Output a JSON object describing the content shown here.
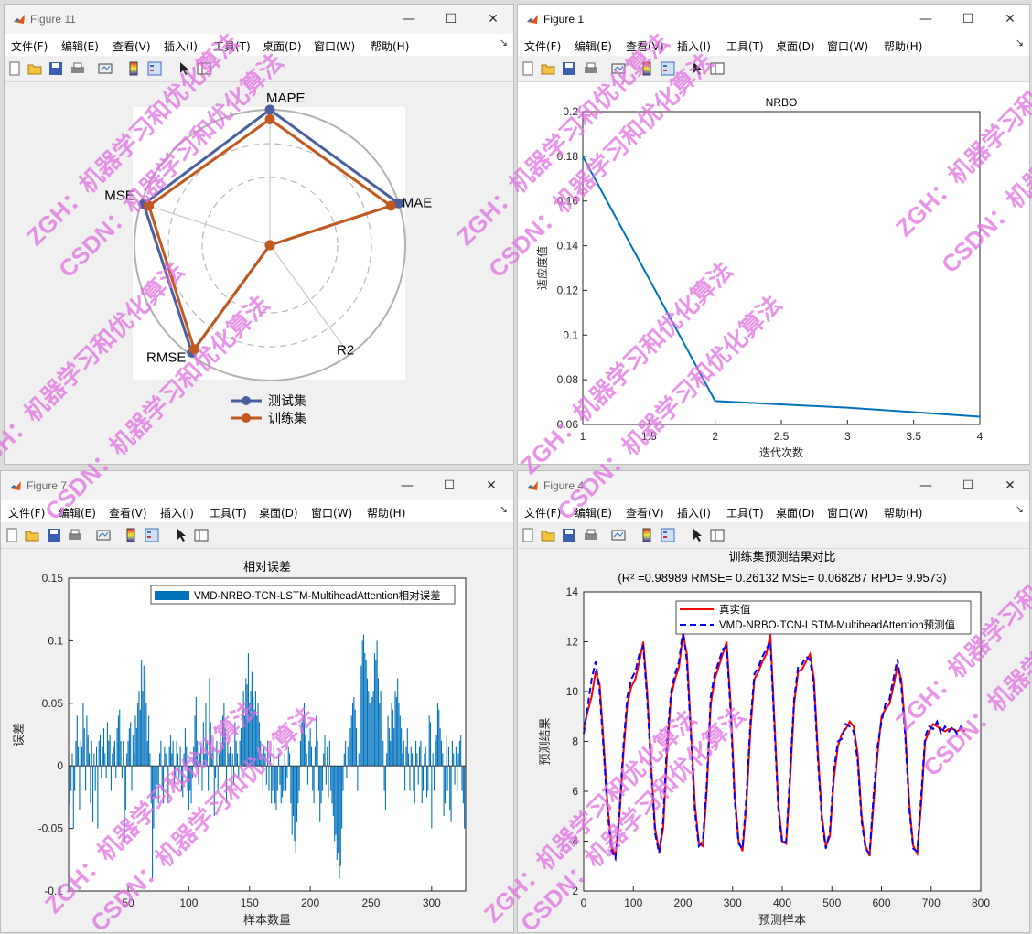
{
  "menus": [
    "文件(F)",
    "编辑(E)",
    "查看(V)",
    "插入(I)",
    "工具(T)",
    "桌面(D)",
    "窗口(W)",
    "帮助(H)"
  ],
  "window_controls": {
    "min": "—",
    "max": "☐",
    "close": "✕"
  },
  "menu_more": "↘",
  "toolbar_icons": [
    "new-figure-icon",
    "open-icon",
    "save-icon",
    "print-icon",
    "link-plot-icon",
    "insert-colorbar-icon",
    "insert-legend-icon",
    "pointer-icon",
    "property-inspector-icon"
  ],
  "watermark": {
    "line1": "ZGH：机器学习和优化算法",
    "line2": "CSDN：机器学习和优化算法",
    "color": "#e070e0"
  },
  "windows": {
    "fig11": {
      "title": "Figure 11"
    },
    "fig1": {
      "title": "Figure 1"
    },
    "fig7": {
      "title": "Figure 7"
    },
    "fig4": {
      "title": "Figure 4"
    }
  },
  "radar": {
    "axes": [
      "MAPE",
      "MAE",
      "R2",
      "RMSE",
      "MSE"
    ],
    "legend": [
      "测试集",
      "训练集"
    ],
    "colors": [
      "#4a5f9e",
      "#c1591f"
    ],
    "series": [
      {
        "name": "测试集",
        "values": [
          1.0,
          1.0,
          0.0,
          0.98,
          0.98
        ]
      },
      {
        "name": "训练集",
        "values": [
          0.93,
          0.94,
          0.0,
          0.95,
          0.94
        ]
      }
    ]
  },
  "chart_data": [
    {
      "type": "radar",
      "axes": [
        "MAPE",
        "MAE",
        "R2",
        "RMSE",
        "MSE"
      ],
      "series": [
        {
          "name": "测试集",
          "values": [
            1.0,
            1.0,
            0.0,
            0.98,
            0.98
          ]
        },
        {
          "name": "训练集",
          "values": [
            0.93,
            0.94,
            0.0,
            0.95,
            0.94
          ]
        }
      ]
    },
    {
      "type": "line",
      "title": "NRBO",
      "xlabel": "迭代次数",
      "ylabel": "适应度值",
      "x": [
        1,
        2,
        3,
        4
      ],
      "y": [
        0.18,
        0.0705,
        0.0675,
        0.0635
      ],
      "xlim": [
        1,
        4
      ],
      "ylim": [
        0.06,
        0.2
      ],
      "xticks": [
        "1",
        "1.5",
        "2",
        "2.5",
        "3",
        "3.5",
        "4"
      ],
      "yticks": [
        "0.06",
        "0.08",
        "0.1",
        "0.12",
        "0.14",
        "0.16",
        "0.18",
        "0.2"
      ],
      "color": "#0072bd"
    },
    {
      "type": "bar",
      "title": "相对误差",
      "xlabel": "样本数量",
      "ylabel": "误差",
      "legend": "VMD-NRBO-TCN-LSTM-MultiheadAttention相对误差",
      "xlim": [
        1,
        328
      ],
      "ylim": [
        -0.1,
        0.15
      ],
      "xticks": [
        "50",
        "100",
        "150",
        "200",
        "250",
        "300"
      ],
      "yticks": [
        "-0.1",
        "-0.05",
        "0",
        "0.05",
        "0.1",
        "0.15"
      ],
      "color": "#0072bd",
      "values": [
        -0.04,
        -0.03,
        -0.02,
        0.01,
        -0.05,
        -0.02,
        0.02,
        0.04,
        0.015,
        -0.035,
        0.02,
        0.015,
        0.05,
        0.03,
        -0.02,
        0.04,
        0.025,
        0.01,
        -0.03,
        0.02,
        -0.045,
        0.01,
        -0.02,
        0.015,
        -0.05,
        0.02,
        0.025,
        -0.01,
        0.015,
        0.03,
        0.01,
        -0.01,
        0.035,
        0.02,
        0.025,
        -0.02,
        0.01,
        0.015,
        0.02,
        -0.01,
        0.03,
        0.04,
        0.045,
        0.02,
        -0.01,
        0.02,
        -0.06,
        -0.035,
        0.01,
        0.02,
        0.03,
        0.035,
        -0.02,
        0.025,
        0.01,
        0.04,
        0.03,
        0.05,
        0.06,
        0.045,
        0.085,
        0.06,
        0.08,
        0.07,
        0.05,
        0.02,
        0.04,
        0.01,
        -0.03,
        -0.09,
        -0.05,
        -0.025,
        -0.04,
        -0.015,
        -0.03,
        0.01,
        0.02,
        -0.02,
        -0.03,
        0.015,
        0.01,
        -0.02,
        -0.03,
        0.015,
        0.025,
        0.01,
        0.02,
        -0.015,
        -0.01,
        0.02,
        0.01,
        -0.01,
        0.015,
        -0.02,
        -0.025,
        0.01,
        0.03,
        0.015,
        -0.02,
        -0.035,
        -0.02,
        -0.03,
        -0.01,
        0.015,
        0.04,
        0.055,
        0.02,
        -0.015,
        0.01,
        0.015,
        -0.02,
        0.035,
        0.01,
        0.05,
        0.02,
        -0.02,
        0.07,
        0.035,
        0.01,
        0.015,
        -0.04,
        -0.01,
        0.02,
        -0.02,
        0.01,
        0.025,
        0.015,
        0.04,
        0.05,
        0.03,
        -0.03,
        0.02,
        0.01,
        0.015,
        -0.02,
        0.01,
        -0.015,
        0.035,
        0.02,
        0.01,
        -0.01,
        0.02,
        0.03,
        0.045,
        0.06,
        0.04,
        0.07,
        0.065,
        0.09,
        0.05,
        0.06,
        0.075,
        0.055,
        0.045,
        0.06,
        0.04,
        0.05,
        0.035,
        0.02,
        0.01,
        -0.02,
        0.015,
        0.01,
        -0.015,
        0.02,
        -0.02,
        0.01,
        -0.03,
        -0.02,
        0.015,
        -0.03,
        -0.035,
        -0.02,
        0.01,
        -0.015,
        -0.03,
        -0.025,
        -0.02,
        0.01,
        -0.02,
        -0.01,
        0.015,
        0.01,
        -0.03,
        -0.055,
        -0.04,
        -0.06,
        -0.07,
        -0.045,
        -0.03,
        -0.02,
        0.02,
        0.035,
        0.04,
        0.05,
        0.025,
        0.01,
        -0.015,
        0.02,
        0.03,
        0.015,
        -0.02,
        -0.03,
        0.015,
        0.04,
        0.02,
        -0.02,
        -0.045,
        -0.03,
        -0.02,
        0.01,
        0.025,
        -0.015,
        0.015,
        -0.025,
        0.02,
        -0.02,
        -0.03,
        -0.04,
        -0.06,
        -0.055,
        -0.075,
        -0.07,
        -0.09,
        -0.08,
        -0.05,
        -0.02,
        0.01,
        0.02,
        -0.01,
        0.015,
        0.02,
        0.03,
        0.04,
        0.05,
        0.055,
        0.045,
        0.03,
        -0.02,
        0.01,
        0.06,
        0.08,
        0.1,
        0.105,
        0.09,
        0.085,
        0.07,
        0.06,
        0.05,
        0.075,
        0.055,
        0.06,
        0.09,
        0.085,
        0.1,
        0.07,
        0.05,
        0.06,
        0.035,
        0.02,
        -0.02,
        -0.035,
        0.01,
        0.04,
        0.03,
        0.02,
        0.05,
        0.045,
        0.03,
        0.06,
        0.055,
        0.07,
        0.05,
        0.04,
        0.03,
        0.01,
        0.02,
        -0.02,
        0.015,
        0.03,
        0.01,
        -0.02,
        0.015,
        0.01,
        -0.02,
        -0.03,
        0.02,
        0.01,
        -0.015,
        0.015,
        0.02,
        -0.03,
        -0.02,
        0.01,
        0.015,
        -0.025,
        -0.02,
        0.04,
        0.035,
        -0.05,
        0.01,
        -0.02,
        0.02,
        0.025,
        0.05,
        0.045,
        0.03,
        0.02,
        0.01,
        -0.04,
        -0.03,
        0.025,
        -0.02,
        0.015,
        -0.035,
        -0.045,
        0.02,
        0.01,
        -0.015,
        0.015,
        -0.02,
        0.01,
        0.02,
        0.025,
        -0.02,
        -0.03,
        -0.05
      ]
    },
    {
      "type": "line",
      "title": "训练集预测结果对比",
      "subtitle": "(R² =0.98989 RMSE= 0.26132 MSE= 0.068287 RPD= 9.9573)",
      "xlabel": "预测样本",
      "ylabel": "预测结果",
      "xlim": [
        0,
        800
      ],
      "ylim": [
        2,
        14
      ],
      "xticks": [
        "0",
        "100",
        "200",
        "300",
        "400",
        "500",
        "600",
        "700",
        "800"
      ],
      "yticks": [
        "2",
        "4",
        "6",
        "8",
        "10",
        "12",
        "14"
      ],
      "series": [
        {
          "name": "真实值",
          "color": "#ff0000",
          "dash": false
        },
        {
          "name": "VMD-NRBO-TCN-LSTM-MultiheadAttention预测值",
          "color": "#0000ff",
          "dash": true
        }
      ],
      "points_x": [
        0,
        8,
        16,
        24,
        32,
        40,
        48,
        56,
        64,
        72,
        80,
        88,
        96,
        104,
        112,
        120,
        128,
        136,
        144,
        152,
        160,
        168,
        176,
        184,
        192,
        200,
        208,
        216,
        224,
        232,
        240,
        248,
        256,
        264,
        272,
        280,
        288,
        296,
        304,
        312,
        320,
        328,
        336,
        344,
        352,
        360,
        368,
        376,
        384,
        392,
        400,
        408,
        416,
        424,
        432,
        440,
        448,
        456,
        464,
        472,
        480,
        488,
        496,
        504,
        512,
        520,
        528,
        536,
        544,
        552,
        560,
        568,
        576,
        584,
        592,
        600,
        608,
        616,
        624,
        632,
        640,
        648,
        656,
        664,
        672,
        680,
        688,
        696,
        704,
        712,
        720,
        728,
        736,
        744,
        752,
        760,
        768
      ],
      "true_y": [
        8.5,
        9.2,
        9.8,
        10.8,
        10.3,
        8.0,
        5.5,
        3.8,
        3.4,
        5.0,
        7.5,
        9.5,
        10.2,
        10.5,
        11.2,
        12.0,
        10.0,
        7.0,
        4.5,
        3.6,
        4.5,
        7.5,
        9.8,
        10.5,
        11.0,
        12.3,
        11.5,
        8.5,
        5.5,
        3.9,
        3.8,
        6.0,
        9.5,
        10.5,
        11.0,
        11.5,
        12.0,
        9.5,
        6.0,
        4.0,
        3.6,
        5.5,
        8.5,
        10.5,
        10.8,
        11.2,
        11.5,
        12.3,
        9.0,
        5.5,
        4.0,
        3.9,
        6.5,
        9.5,
        10.8,
        10.9,
        11.2,
        11.5,
        10.5,
        7.5,
        5.0,
        3.8,
        4.2,
        6.5,
        7.8,
        8.3,
        8.5,
        8.8,
        8.6,
        7.5,
        5.0,
        3.8,
        3.4,
        5.5,
        7.5,
        9.0,
        9.3,
        9.5,
        10.2,
        11.0,
        10.5,
        8.5,
        5.5,
        3.8,
        3.5,
        5.5,
        8.0,
        8.4,
        8.7,
        8.6,
        8.5,
        8.4,
        8.5,
        8.5,
        8.4,
        8.5,
        8.4
      ],
      "pred_y": [
        8.3,
        9.4,
        10.5,
        11.2,
        10.0,
        7.7,
        5.2,
        3.6,
        3.3,
        5.2,
        7.8,
        9.8,
        10.5,
        10.8,
        11.5,
        11.8,
        9.7,
        6.8,
        4.3,
        3.5,
        4.8,
        8.0,
        10.0,
        10.7,
        11.2,
        12.5,
        11.2,
        8.2,
        5.2,
        3.8,
        4.0,
        6.3,
        9.8,
        10.7,
        11.2,
        11.7,
        11.8,
        9.2,
        5.7,
        3.9,
        3.7,
        5.8,
        8.8,
        10.7,
        11.0,
        11.4,
        11.7,
        12.0,
        8.7,
        5.3,
        3.9,
        4.0,
        6.8,
        9.7,
        11.0,
        11.1,
        11.4,
        11.3,
        10.2,
        7.2,
        4.8,
        3.7,
        4.4,
        6.8,
        8.0,
        8.1,
        8.7,
        8.6,
        8.4,
        7.2,
        4.8,
        3.7,
        3.5,
        5.8,
        7.8,
        8.8,
        9.5,
        9.7,
        10.5,
        11.3,
        10.2,
        8.2,
        5.3,
        3.7,
        3.6,
        5.8,
        8.2,
        8.6,
        8.5,
        8.8,
        8.3,
        8.6,
        8.4,
        8.6,
        8.3,
        8.6,
        8.4
      ]
    }
  ]
}
